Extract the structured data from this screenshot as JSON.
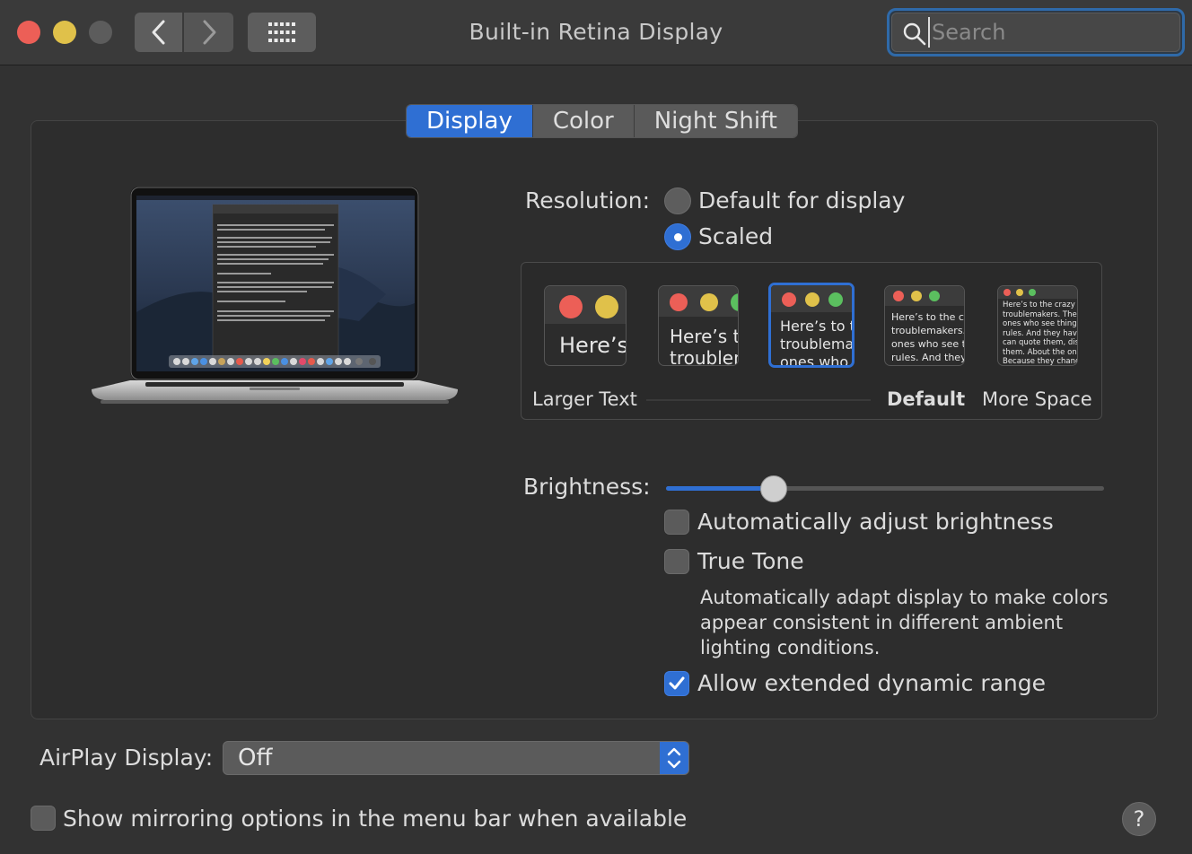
{
  "window": {
    "title": "Built-in Retina Display"
  },
  "toolbar": {
    "search_placeholder": "Search"
  },
  "tabs": [
    {
      "label": "Display",
      "active": true
    },
    {
      "label": "Color",
      "active": false
    },
    {
      "label": "Night Shift",
      "active": false
    }
  ],
  "resolution": {
    "label": "Resolution:",
    "options": [
      {
        "label": "Default for display",
        "selected": false
      },
      {
        "label": "Scaled",
        "selected": true
      }
    ],
    "scale_labels": {
      "larger": "Larger Text",
      "default": "Default",
      "more": "More Space"
    },
    "thumbnails": [
      {
        "text": "Here’s"
      },
      {
        "text": "Here’s to\ntroublem"
      },
      {
        "text": "Here’s to t\ntroublema\nones who"
      },
      {
        "text": "Here’s to the cr\ntroublemakers.\nones who see t\nrules. And they"
      },
      {
        "text": "Here’s to the crazy one\ntroublemakers. The rou\nones who see things dif\nrules. And they have no\ncan quote them, disagre\nthem. About the only th\nBecause they change th"
      }
    ]
  },
  "brightness": {
    "label": "Brightness:",
    "value": 0.245,
    "auto_label": "Automatically adjust brightness",
    "auto_checked": false
  },
  "true_tone": {
    "label": "True Tone",
    "checked": false,
    "description": "Automatically adapt display to make colors appear consistent in different ambient lighting conditions."
  },
  "edr": {
    "label": "Allow extended dynamic range",
    "checked": true
  },
  "airplay": {
    "label": "AirPlay Display:",
    "value": "Off"
  },
  "mirroring": {
    "label": "Show mirroring options in the menu bar when available",
    "checked": false
  },
  "help": {
    "label": "?"
  },
  "colors": {
    "accent": "#2f6fd3",
    "close": "#ec5f57",
    "minimize": "#e0c14a",
    "zoom_disabled": "#5c5c5c"
  }
}
